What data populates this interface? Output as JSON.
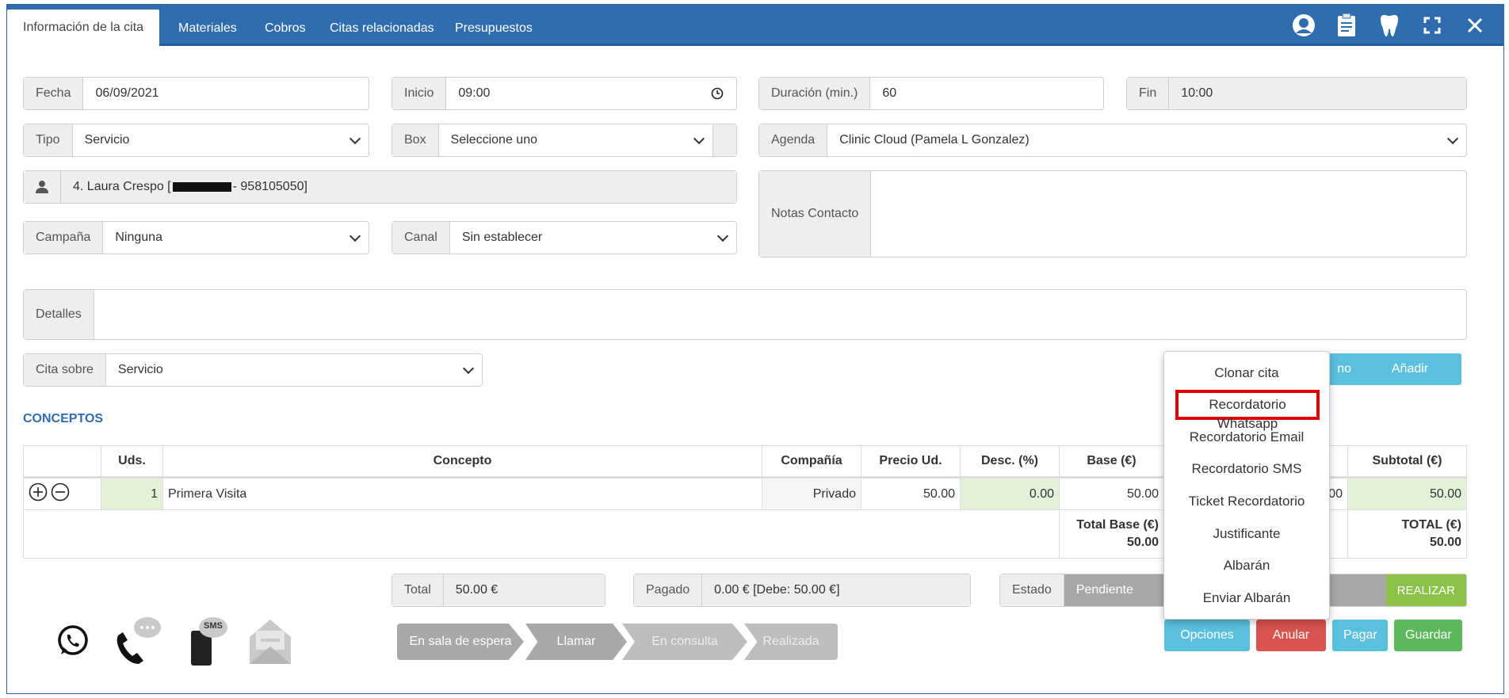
{
  "tabs": [
    {
      "label": "Información de la cita"
    },
    {
      "label": "Materiales"
    },
    {
      "label": "Cobros"
    },
    {
      "label": "Citas relacionadas"
    },
    {
      "label": "Presupuestos"
    }
  ],
  "form": {
    "fecha": {
      "label": "Fecha",
      "value": "06/09/2021"
    },
    "inicio": {
      "label": "Inicio",
      "value": "09:00"
    },
    "duracion": {
      "label": "Duración (min.)",
      "value": "60"
    },
    "fin": {
      "label": "Fin",
      "value": "10:00"
    },
    "tipo": {
      "label": "Tipo",
      "value": "Servicio"
    },
    "box": {
      "label": "Box",
      "value": "Seleccione uno"
    },
    "agenda": {
      "label": "Agenda",
      "value": "Clinic Cloud (Pamela L Gonzalez)"
    },
    "patient": {
      "prefix": "4. Laura Crespo [",
      "suffix": " - 958105050]"
    },
    "notas": {
      "label": "Notas Contacto",
      "value": ""
    },
    "campana": {
      "label": "Campaña",
      "value": "Ninguna"
    },
    "canal": {
      "label": "Canal",
      "value": "Sin establecer"
    },
    "detalles": {
      "label": "Detalles",
      "value": ""
    },
    "cita_sobre": {
      "label": "Cita sobre",
      "value": "Servicio"
    }
  },
  "buttons": {
    "partial_hidden": "no",
    "anadir_servicio": "Añadir servicio",
    "realizar": "REALIZAR",
    "opciones": "Opciones",
    "anular": "Anular",
    "pagar": "Pagar",
    "guardar": "Guardar"
  },
  "conceptos": {
    "title": "CONCEPTOS",
    "headers": [
      "Uds.",
      "Concepto",
      "Compañía",
      "Precio Ud.",
      "Desc. (%)",
      "Base (€)",
      "Subtotal (€)"
    ],
    "row": {
      "uds": "1",
      "concepto": "Primera Visita",
      "compania": "Privado",
      "precio": "50.00",
      "desc": "0.00",
      "base": "50.00",
      "hidden": "00",
      "subtotal": "50.00"
    },
    "totals": {
      "base_label": "Total Base (€)",
      "base_value": "50.00",
      "total_label": "TOTAL (€)",
      "total_value": "50.00"
    }
  },
  "summary": {
    "total": {
      "label": "Total",
      "value": "50.00 €"
    },
    "pagado": {
      "label": "Pagado",
      "value": "0.00 € [Debe: 50.00 €]"
    },
    "estado": {
      "label": "Estado",
      "value": "Pendiente"
    }
  },
  "steps": [
    "En sala de espera",
    "Llamar",
    "En consulta",
    "Realizada"
  ],
  "menu": {
    "items": [
      "Clonar cita",
      "Recordatorio Whatsapp",
      "Recordatorio Email",
      "Recordatorio SMS",
      "Ticket Recordatorio",
      "Justificante",
      "Albarán",
      "Enviar Albarán"
    ]
  },
  "sms_badge": "SMS",
  "colors": {
    "header": "#2f6dae",
    "info": "#5bc0de",
    "danger": "#d9534f",
    "success": "#5cb85c",
    "olive": "#8bc34a",
    "highlight": "#e00000"
  }
}
